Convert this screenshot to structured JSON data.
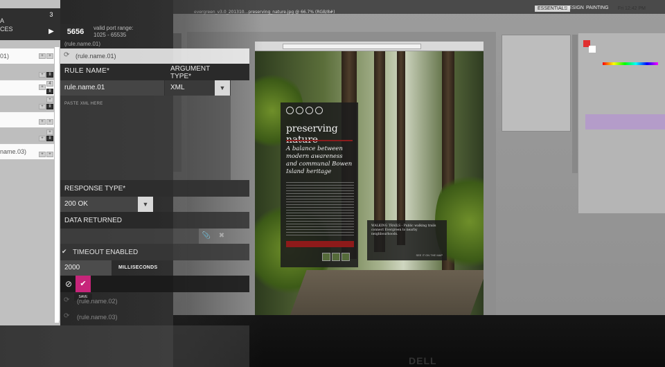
{
  "app_list": {
    "header_lines": [
      "A",
      "CES"
    ],
    "count": "3",
    "play_icon": "play-icon",
    "items": [
      {
        "label": "01)",
        "style": "white"
      },
      {
        "label": "",
        "style": "grey"
      },
      {
        "label": "",
        "style": "white"
      },
      {
        "label": "",
        "style": "grey"
      },
      {
        "label": "",
        "style": "white"
      },
      {
        "label": "",
        "style": "grey"
      },
      {
        "label": "",
        "style": "white"
      },
      {
        "label": "name.03)",
        "style": "white"
      }
    ],
    "mini_badge_4": "4",
    "pause_glyph": "II",
    "plus_glyph": "+"
  },
  "editor": {
    "port": {
      "value": "5656",
      "hint_line1": "valid port range:",
      "hint_line2": "1025 - 65535",
      "name_small": "(rule.name.01)"
    },
    "active_rule": "(rule.name.01)",
    "rule_name_label": "RULE NAME*",
    "argument_type_label_1": "ARGUMENT",
    "argument_type_label_2": "TYPE*",
    "rule_name_value": "rule.name.01",
    "argument_type_value": "XML",
    "xml_placeholder": "PASTE XML HERE",
    "response_type_label": "RESPONSE TYPE*",
    "response_type_value": "200 OK",
    "data_returned_label": "DATA RETURNED",
    "timeout_label": "TIMEOUT ENABLED",
    "timeout_value": "2000",
    "timeout_unit": "MILLISECONDS",
    "save_tooltip": "SAVE",
    "other_rules": [
      "(rule.name.02)",
      "(rule.name.03)"
    ],
    "icons": {
      "refresh": "⟳",
      "dropdown": "▼",
      "attach": "📎",
      "clear": "✖",
      "check": "✔",
      "cancel": "⊘",
      "save": "✔",
      "play": "▶"
    }
  },
  "background": {
    "menu_items": [
      "ESSENTIALS",
      "DESIGN",
      "PAINTING"
    ],
    "clock": "Fri 12:42 PM",
    "site_title": "preserving nature",
    "site_headline": "A balance between modern awareness and communal Bowen Island heritage",
    "trail_text": "WALKING TRAILS - Public walking trails connect Evergreen to nearby neighbourhoods.",
    "trail_link": "SEE IT ON THE MAP",
    "bezel_logo": "DELL"
  }
}
